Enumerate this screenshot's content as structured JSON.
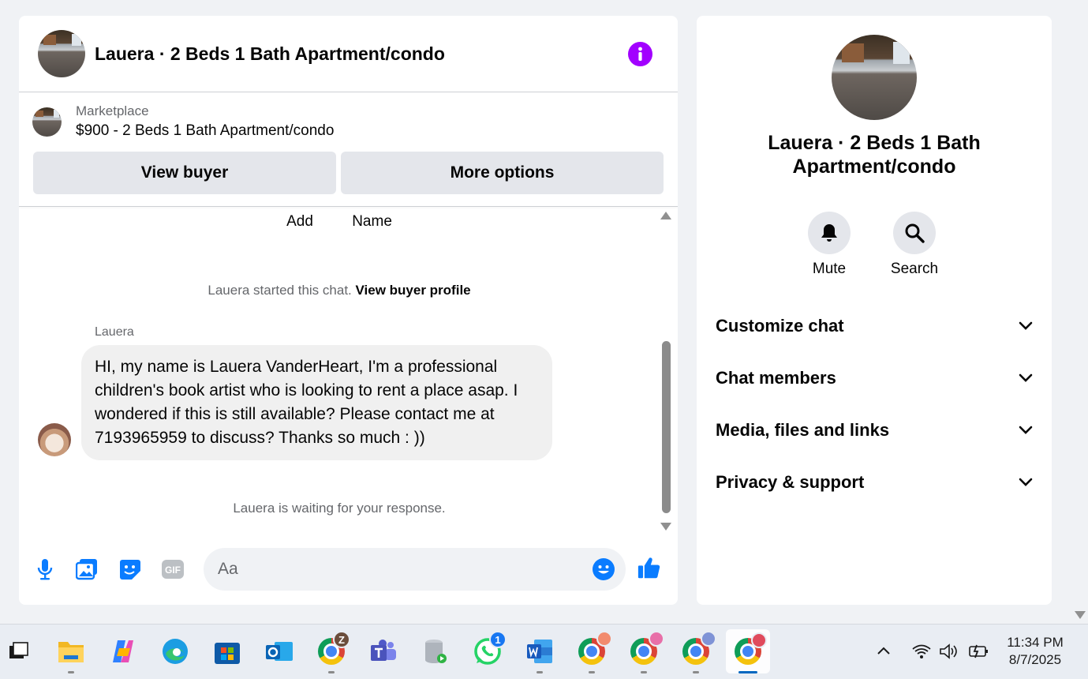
{
  "chat": {
    "title": "Lauera · 2 Beds 1 Bath Apartment/condo",
    "marketplace_label": "Marketplace",
    "listing": "$900 - 2 Beds 1 Bath Apartment/condo",
    "view_buyer": "View buyer",
    "more_options": "More options",
    "add": "Add",
    "name": "Name",
    "started_text": "Lauera started this chat.",
    "view_buyer_profile": "View buyer profile",
    "sender": "Lauera",
    "message": "HI, my name is Lauera VanderHeart, I'm a professional children's book artist who is looking to rent a place asap. I wondered if this is still available? Please contact me at 7193965959 to discuss? Thanks so much : ))",
    "waiting": "Lauera is waiting for your response.",
    "input_placeholder": "Aa",
    "gif_label": "GIF"
  },
  "details": {
    "title": "Lauera · 2 Beds 1 Bath Apartment/condo",
    "mute": "Mute",
    "search": "Search",
    "sections": [
      "Customize chat",
      "Chat members",
      "Media, files and links",
      "Privacy & support"
    ]
  },
  "taskbar": {
    "apps": [
      "task-view",
      "file-explorer",
      "copilot",
      "edge",
      "microsoft-store",
      "outlook",
      "chrome-profile-z",
      "teams",
      "database-app",
      "whatsapp",
      "word",
      "chrome-profile-1",
      "chrome-profile-2",
      "chrome-profile-3",
      "chrome-profile-4"
    ],
    "chrome_z_badge": "Z",
    "whatsapp_badge": "1",
    "time": "11:34 PM",
    "date": "8/7/2025"
  },
  "colors": {
    "accent": "#0a7cff",
    "info": "#a200ff",
    "bubble": "#f0f0f0"
  }
}
